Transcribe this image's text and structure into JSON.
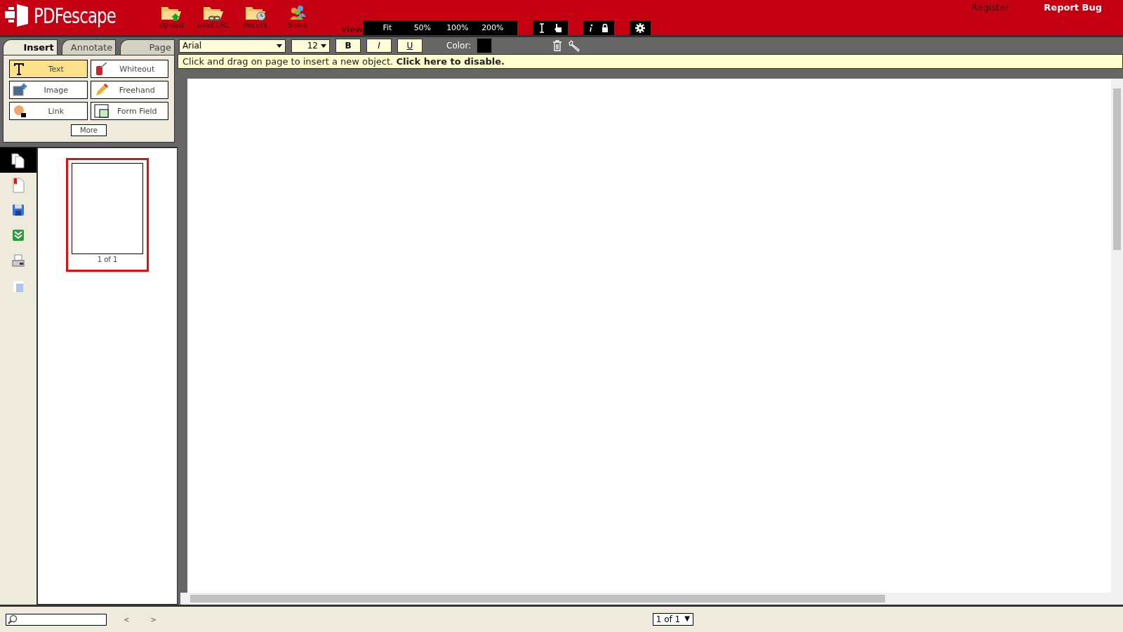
{
  "header": {
    "logo": "PDFescape",
    "actions": [
      {
        "label": "Upload",
        "kind": "upload"
      },
      {
        "label": "Load URL",
        "kind": "link"
      },
      {
        "label": "Recent",
        "kind": "recent"
      },
      {
        "label": "Share",
        "kind": "share"
      }
    ],
    "view_label": "View",
    "zoom": [
      {
        "label": "Fit",
        "selected": false
      },
      {
        "label": "50%",
        "selected": false
      },
      {
        "label": "100%",
        "selected": false
      },
      {
        "label": "200%",
        "selected": false
      }
    ],
    "links": [
      {
        "label": "Register",
        "kind": "muted"
      },
      {
        "label": "Report Bug",
        "kind": "bright"
      }
    ]
  },
  "tabs": [
    {
      "label": "Insert",
      "selected": true
    },
    {
      "label": "Annotate",
      "selected": false
    },
    {
      "label": "Page",
      "selected": false
    }
  ],
  "tools": [
    {
      "label": "Text",
      "kind": "text",
      "selected": true
    },
    {
      "label": "Whiteout",
      "kind": "whiteout",
      "selected": false
    },
    {
      "label": "Image",
      "kind": "image",
      "selected": false
    },
    {
      "label": "Freehand",
      "kind": "freehand",
      "selected": false
    },
    {
      "label": "Link",
      "kind": "link",
      "selected": false
    },
    {
      "label": "Form Field",
      "kind": "formfield",
      "selected": false
    }
  ],
  "more": "More",
  "format": {
    "font": "Arial",
    "size": "12",
    "bold": "B",
    "italic": "I",
    "underline": "U",
    "color_label": "Color:",
    "color": "#000000"
  },
  "notice": "Click and drag on page to insert a new object. **Click here to disable.**",
  "side_icons": [
    {
      "kind": "pages",
      "selected": true
    },
    {
      "kind": "bookmarks",
      "selected": false
    },
    {
      "kind": "save",
      "selected": false
    },
    {
      "kind": "download",
      "selected": false
    },
    {
      "kind": "print",
      "selected": false
    },
    {
      "kind": "page",
      "selected": false
    }
  ],
  "thumbnail": {
    "label": "1 of 1",
    "selected": true
  },
  "footer": {
    "prev": "<",
    "next": ">",
    "page": "1 of 1",
    "caret": "▼"
  }
}
